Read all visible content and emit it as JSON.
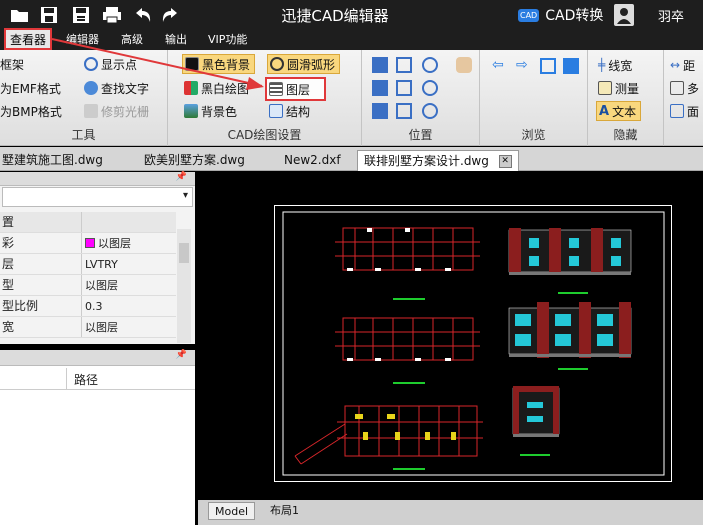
{
  "app": {
    "title": "迅捷CAD编辑器",
    "convert_badge": "CAD",
    "convert_label": "CAD转换",
    "user_name": "羽卒"
  },
  "menu": {
    "items": [
      "查看器",
      "编辑器",
      "高级",
      "输出",
      "VIP功能"
    ]
  },
  "ribbon": {
    "tools": {
      "items": [
        "框架",
        "为EMF格式",
        "为BMP格式",
        "显示点",
        "查找文字",
        "修剪光栅"
      ],
      "title": "工具"
    },
    "cad_settings": {
      "items": [
        "黑色背景",
        "黑白绘图",
        "背景色",
        "圆滑弧形",
        "图层",
        "结构"
      ],
      "title": "CAD绘图设置"
    },
    "position": {
      "title": "位置"
    },
    "browse": {
      "title": "浏览"
    },
    "hide": {
      "items": [
        "线宽",
        "测量",
        "文本"
      ],
      "title": "隐藏"
    },
    "extra": {
      "items": [
        "距",
        "多",
        "面"
      ]
    }
  },
  "doc_tabs": [
    "墅建筑施工图.dwg",
    "欧美别墅方案.dwg",
    "New2.dxf",
    "联排别墅方案设计.dwg"
  ],
  "properties": {
    "dropdown_value": "",
    "rows": [
      {
        "name": "置",
        "value": ""
      },
      {
        "name": "彩",
        "value": "以图层"
      },
      {
        "name": "层",
        "value": "LVTRY"
      },
      {
        "name": "型",
        "value": "以图层"
      },
      {
        "name": "型比例",
        "value": "0.3"
      },
      {
        "name": "宽",
        "value": "以图层"
      }
    ],
    "color_swatch": "#ff00ff"
  },
  "path_panel": {
    "column": "路径"
  },
  "layout_tabs": [
    "Model",
    "布局1"
  ],
  "colors": {
    "highlight": "#e0383a",
    "title_bg": "#1e1e1e",
    "drawing_red": "#d8262a",
    "drawing_green": "#1ecc2e",
    "drawing_cyan": "#24c8d8",
    "drawing_yellow": "#e8d41a"
  }
}
